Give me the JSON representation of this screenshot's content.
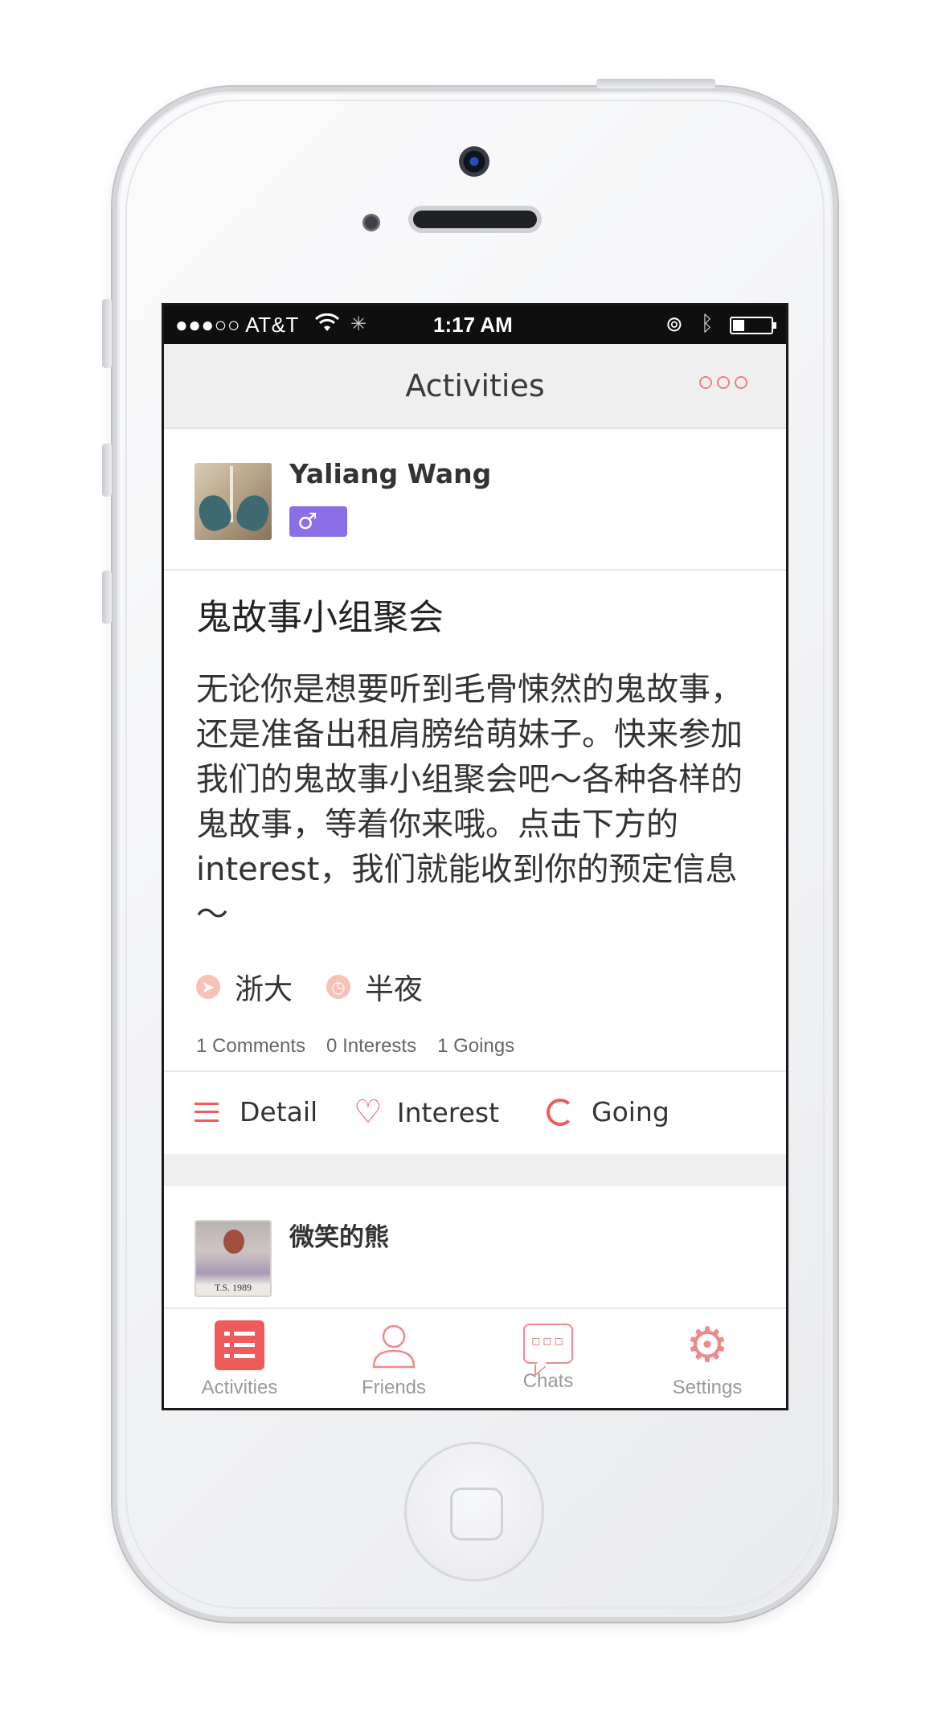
{
  "status_bar": {
    "carrier": "●●●○○ AT&T",
    "wifi_icon": "wifi-icon",
    "time": "1:17 AM",
    "battery_level": 0.3
  },
  "nav": {
    "title": "Activities"
  },
  "post": {
    "author": "Yaliang Wang",
    "gender_symbol": "♂",
    "title": "鬼故事小组聚会",
    "body": "无论你是想要听到毛骨悚然的鬼故事，还是准备出租肩膀给萌妹子。快来参加我们的鬼故事小组聚会吧～各种各样的鬼故事，等着你来哦。点击下方的interest，我们就能收到你的预定信息～",
    "location": "浙大",
    "time": "半夜",
    "stats": {
      "comments": "1 Comments",
      "interests": "0 Interests",
      "goings": "1 Goings"
    },
    "actions": {
      "detail": "Detail",
      "interest": "Interest",
      "going": "Going"
    }
  },
  "next_post": {
    "author": "微笑的熊",
    "avatar_caption": "T.S.    1989"
  },
  "tabs": [
    {
      "label": "Activities",
      "icon": "list-icon",
      "active": true
    },
    {
      "label": "Friends",
      "icon": "person-icon",
      "active": false
    },
    {
      "label": "Chats",
      "icon": "chat-bubble-icon",
      "active": false
    },
    {
      "label": "Settings",
      "icon": "gear-icon",
      "active": false
    }
  ],
  "colors": {
    "accent": "#ef5a5a",
    "gender_badge": "#8b6fe8",
    "nav_bg": "#efeff0"
  }
}
